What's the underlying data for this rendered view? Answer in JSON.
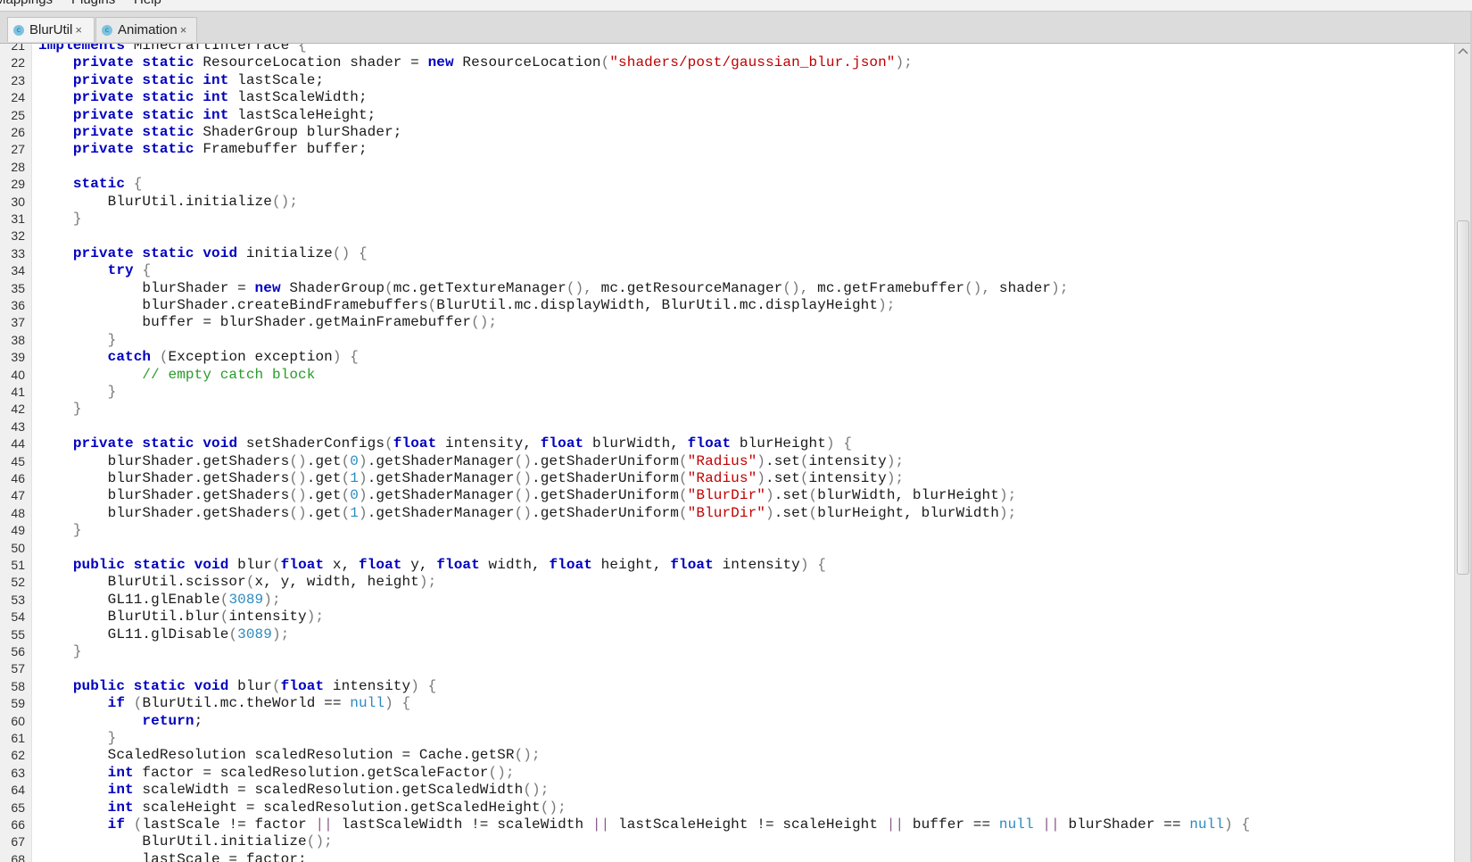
{
  "menu": {
    "items": [
      "Mappings",
      "Plugins",
      "Help"
    ]
  },
  "tabs": [
    {
      "label": "BlurUtil",
      "icon": "class-icon",
      "icon_glyph": "c",
      "close": "×",
      "active": true
    },
    {
      "label": "Animation",
      "icon": "class-icon",
      "icon_glyph": "c",
      "close": "×",
      "active": false
    }
  ],
  "editor": {
    "colors": {
      "keyword": "#0000c0",
      "string": "#c00000",
      "number": "#2b8ac0",
      "comment": "#2a9a2a"
    },
    "first_line_number": 21,
    "lines": [
      [
        [
          "kw",
          "implements"
        ],
        [
          "t",
          " MinecraftInterface "
        ],
        [
          "pn",
          "{"
        ]
      ],
      [
        [
          "t",
          "    "
        ],
        [
          "kw",
          "private static"
        ],
        [
          "t",
          " ResourceLocation shader = "
        ],
        [
          "kw",
          "new"
        ],
        [
          "t",
          " ResourceLocation"
        ],
        [
          "pn",
          "("
        ],
        [
          "str",
          "\"shaders/post/gaussian_blur.json\""
        ],
        [
          "pn",
          ");"
        ]
      ],
      [
        [
          "t",
          "    "
        ],
        [
          "kw",
          "private static int"
        ],
        [
          "t",
          " lastScale;"
        ]
      ],
      [
        [
          "t",
          "    "
        ],
        [
          "kw",
          "private static int"
        ],
        [
          "t",
          " lastScaleWidth;"
        ]
      ],
      [
        [
          "t",
          "    "
        ],
        [
          "kw",
          "private static int"
        ],
        [
          "t",
          " lastScaleHeight;"
        ]
      ],
      [
        [
          "t",
          "    "
        ],
        [
          "kw",
          "private static"
        ],
        [
          "t",
          " ShaderGroup blurShader;"
        ]
      ],
      [
        [
          "t",
          "    "
        ],
        [
          "kw",
          "private static"
        ],
        [
          "t",
          " Framebuffer buffer;"
        ]
      ],
      [],
      [
        [
          "t",
          "    "
        ],
        [
          "kw",
          "static"
        ],
        [
          "t",
          " "
        ],
        [
          "pn",
          "{"
        ]
      ],
      [
        [
          "t",
          "        BlurUtil.initialize"
        ],
        [
          "pn",
          "();"
        ]
      ],
      [
        [
          "t",
          "    "
        ],
        [
          "pn",
          "}"
        ]
      ],
      [],
      [
        [
          "t",
          "    "
        ],
        [
          "kw",
          "private static void"
        ],
        [
          "t",
          " initialize"
        ],
        [
          "pn",
          "()"
        ],
        [
          "t",
          " "
        ],
        [
          "pn",
          "{"
        ]
      ],
      [
        [
          "t",
          "        "
        ],
        [
          "kw",
          "try"
        ],
        [
          "t",
          " "
        ],
        [
          "pn",
          "{"
        ]
      ],
      [
        [
          "t",
          "            blurShader = "
        ],
        [
          "kw",
          "new"
        ],
        [
          "t",
          " ShaderGroup"
        ],
        [
          "pn",
          "("
        ],
        [
          "t",
          "mc.getTextureManager"
        ],
        [
          "pn",
          "(),"
        ],
        [
          "t",
          " mc.getResourceManager"
        ],
        [
          "pn",
          "(),"
        ],
        [
          "t",
          " mc.getFramebuffer"
        ],
        [
          "pn",
          "(),"
        ],
        [
          "t",
          " shader"
        ],
        [
          "pn",
          ");"
        ]
      ],
      [
        [
          "t",
          "            blurShader.createBindFramebuffers"
        ],
        [
          "pn",
          "("
        ],
        [
          "t",
          "BlurUtil.mc.displayWidth, BlurUtil.mc.displayHeight"
        ],
        [
          "pn",
          ");"
        ]
      ],
      [
        [
          "t",
          "            buffer = blurShader.getMainFramebuffer"
        ],
        [
          "pn",
          "();"
        ]
      ],
      [
        [
          "t",
          "        "
        ],
        [
          "pn",
          "}"
        ]
      ],
      [
        [
          "t",
          "        "
        ],
        [
          "kw",
          "catch"
        ],
        [
          "t",
          " "
        ],
        [
          "pn",
          "("
        ],
        [
          "t",
          "Exception exception"
        ],
        [
          "pn",
          ")"
        ],
        [
          "t",
          " "
        ],
        [
          "pn",
          "{"
        ]
      ],
      [
        [
          "t",
          "            "
        ],
        [
          "cm",
          "// empty catch block"
        ]
      ],
      [
        [
          "t",
          "        "
        ],
        [
          "pn",
          "}"
        ]
      ],
      [
        [
          "t",
          "    "
        ],
        [
          "pn",
          "}"
        ]
      ],
      [],
      [
        [
          "t",
          "    "
        ],
        [
          "kw",
          "private static void"
        ],
        [
          "t",
          " setShaderConfigs"
        ],
        [
          "pn",
          "("
        ],
        [
          "kw",
          "float"
        ],
        [
          "t",
          " intensity, "
        ],
        [
          "kw",
          "float"
        ],
        [
          "t",
          " blurWidth, "
        ],
        [
          "kw",
          "float"
        ],
        [
          "t",
          " blurHeight"
        ],
        [
          "pn",
          ")"
        ],
        [
          "t",
          " "
        ],
        [
          "pn",
          "{"
        ]
      ],
      [
        [
          "t",
          "        blurShader.getShaders"
        ],
        [
          "pn",
          "()"
        ],
        [
          "t",
          ".get"
        ],
        [
          "pn",
          "("
        ],
        [
          "num",
          "0"
        ],
        [
          "pn",
          ")"
        ],
        [
          "t",
          ".getShaderManager"
        ],
        [
          "pn",
          "()"
        ],
        [
          "t",
          ".getShaderUniform"
        ],
        [
          "pn",
          "("
        ],
        [
          "str",
          "\"Radius\""
        ],
        [
          "pn",
          ")"
        ],
        [
          "t",
          ".set"
        ],
        [
          "pn",
          "("
        ],
        [
          "t",
          "intensity"
        ],
        [
          "pn",
          ");"
        ]
      ],
      [
        [
          "t",
          "        blurShader.getShaders"
        ],
        [
          "pn",
          "()"
        ],
        [
          "t",
          ".get"
        ],
        [
          "pn",
          "("
        ],
        [
          "num",
          "1"
        ],
        [
          "pn",
          ")"
        ],
        [
          "t",
          ".getShaderManager"
        ],
        [
          "pn",
          "()"
        ],
        [
          "t",
          ".getShaderUniform"
        ],
        [
          "pn",
          "("
        ],
        [
          "str",
          "\"Radius\""
        ],
        [
          "pn",
          ")"
        ],
        [
          "t",
          ".set"
        ],
        [
          "pn",
          "("
        ],
        [
          "t",
          "intensity"
        ],
        [
          "pn",
          ");"
        ]
      ],
      [
        [
          "t",
          "        blurShader.getShaders"
        ],
        [
          "pn",
          "()"
        ],
        [
          "t",
          ".get"
        ],
        [
          "pn",
          "("
        ],
        [
          "num",
          "0"
        ],
        [
          "pn",
          ")"
        ],
        [
          "t",
          ".getShaderManager"
        ],
        [
          "pn",
          "()"
        ],
        [
          "t",
          ".getShaderUniform"
        ],
        [
          "pn",
          "("
        ],
        [
          "str",
          "\"BlurDir\""
        ],
        [
          "pn",
          ")"
        ],
        [
          "t",
          ".set"
        ],
        [
          "pn",
          "("
        ],
        [
          "t",
          "blurWidth, blurHeight"
        ],
        [
          "pn",
          ");"
        ]
      ],
      [
        [
          "t",
          "        blurShader.getShaders"
        ],
        [
          "pn",
          "()"
        ],
        [
          "t",
          ".get"
        ],
        [
          "pn",
          "("
        ],
        [
          "num",
          "1"
        ],
        [
          "pn",
          ")"
        ],
        [
          "t",
          ".getShaderManager"
        ],
        [
          "pn",
          "()"
        ],
        [
          "t",
          ".getShaderUniform"
        ],
        [
          "pn",
          "("
        ],
        [
          "str",
          "\"BlurDir\""
        ],
        [
          "pn",
          ")"
        ],
        [
          "t",
          ".set"
        ],
        [
          "pn",
          "("
        ],
        [
          "t",
          "blurHeight, blurWidth"
        ],
        [
          "pn",
          ");"
        ]
      ],
      [
        [
          "t",
          "    "
        ],
        [
          "pn",
          "}"
        ]
      ],
      [],
      [
        [
          "t",
          "    "
        ],
        [
          "kw",
          "public static void"
        ],
        [
          "t",
          " blur"
        ],
        [
          "pn",
          "("
        ],
        [
          "kw",
          "float"
        ],
        [
          "t",
          " x, "
        ],
        [
          "kw",
          "float"
        ],
        [
          "t",
          " y, "
        ],
        [
          "kw",
          "float"
        ],
        [
          "t",
          " width, "
        ],
        [
          "kw",
          "float"
        ],
        [
          "t",
          " height, "
        ],
        [
          "kw",
          "float"
        ],
        [
          "t",
          " intensity"
        ],
        [
          "pn",
          ")"
        ],
        [
          "t",
          " "
        ],
        [
          "pn",
          "{"
        ]
      ],
      [
        [
          "t",
          "        BlurUtil.scissor"
        ],
        [
          "pn",
          "("
        ],
        [
          "t",
          "x, y, width, height"
        ],
        [
          "pn",
          ");"
        ]
      ],
      [
        [
          "t",
          "        GL11.glEnable"
        ],
        [
          "pn",
          "("
        ],
        [
          "num",
          "3089"
        ],
        [
          "pn",
          ");"
        ]
      ],
      [
        [
          "t",
          "        BlurUtil.blur"
        ],
        [
          "pn",
          "("
        ],
        [
          "t",
          "intensity"
        ],
        [
          "pn",
          ");"
        ]
      ],
      [
        [
          "t",
          "        GL11.glDisable"
        ],
        [
          "pn",
          "("
        ],
        [
          "num",
          "3089"
        ],
        [
          "pn",
          ");"
        ]
      ],
      [
        [
          "t",
          "    "
        ],
        [
          "pn",
          "}"
        ]
      ],
      [],
      [
        [
          "t",
          "    "
        ],
        [
          "kw",
          "public static void"
        ],
        [
          "t",
          " blur"
        ],
        [
          "pn",
          "("
        ],
        [
          "kw",
          "float"
        ],
        [
          "t",
          " intensity"
        ],
        [
          "pn",
          ")"
        ],
        [
          "t",
          " "
        ],
        [
          "pn",
          "{"
        ]
      ],
      [
        [
          "t",
          "        "
        ],
        [
          "kw",
          "if"
        ],
        [
          "t",
          " "
        ],
        [
          "pn",
          "("
        ],
        [
          "t",
          "BlurUtil.mc.theWorld == "
        ],
        [
          "num",
          "null"
        ],
        [
          "pn",
          ")"
        ],
        [
          "t",
          " "
        ],
        [
          "pn",
          "{"
        ]
      ],
      [
        [
          "t",
          "            "
        ],
        [
          "kw",
          "return"
        ],
        [
          "t",
          ";"
        ]
      ],
      [
        [
          "t",
          "        "
        ],
        [
          "pn",
          "}"
        ]
      ],
      [
        [
          "t",
          "        ScaledResolution scaledResolution = Cache.getSR"
        ],
        [
          "pn",
          "();"
        ]
      ],
      [
        [
          "t",
          "        "
        ],
        [
          "kw",
          "int"
        ],
        [
          "t",
          " factor = scaledResolution.getScaleFactor"
        ],
        [
          "pn",
          "();"
        ]
      ],
      [
        [
          "t",
          "        "
        ],
        [
          "kw",
          "int"
        ],
        [
          "t",
          " scaleWidth = scaledResolution.getScaledWidth"
        ],
        [
          "pn",
          "();"
        ]
      ],
      [
        [
          "t",
          "        "
        ],
        [
          "kw",
          "int"
        ],
        [
          "t",
          " scaleHeight = scaledResolution.getScaledHeight"
        ],
        [
          "pn",
          "();"
        ]
      ],
      [
        [
          "t",
          "        "
        ],
        [
          "kw",
          "if"
        ],
        [
          "t",
          " "
        ],
        [
          "pn",
          "("
        ],
        [
          "t",
          "lastScale != factor "
        ],
        [
          "op",
          "||"
        ],
        [
          "t",
          " lastScaleWidth != scaleWidth "
        ],
        [
          "op",
          "||"
        ],
        [
          "t",
          " lastScaleHeight != scaleHeight "
        ],
        [
          "op",
          "||"
        ],
        [
          "t",
          " buffer == "
        ],
        [
          "num",
          "null"
        ],
        [
          "t",
          " "
        ],
        [
          "op",
          "||"
        ],
        [
          "t",
          " blurShader == "
        ],
        [
          "num",
          "null"
        ],
        [
          "pn",
          ")"
        ],
        [
          "t",
          " "
        ],
        [
          "pn",
          "{"
        ]
      ],
      [
        [
          "t",
          "            BlurUtil.initialize"
        ],
        [
          "pn",
          "();"
        ]
      ],
      [
        [
          "t",
          "            lastScale = factor;"
        ]
      ]
    ]
  },
  "scrollbar": {
    "up_icon": "^",
    "thumb_start_fraction": 0.2,
    "thumb_end_fraction": 0.64
  }
}
